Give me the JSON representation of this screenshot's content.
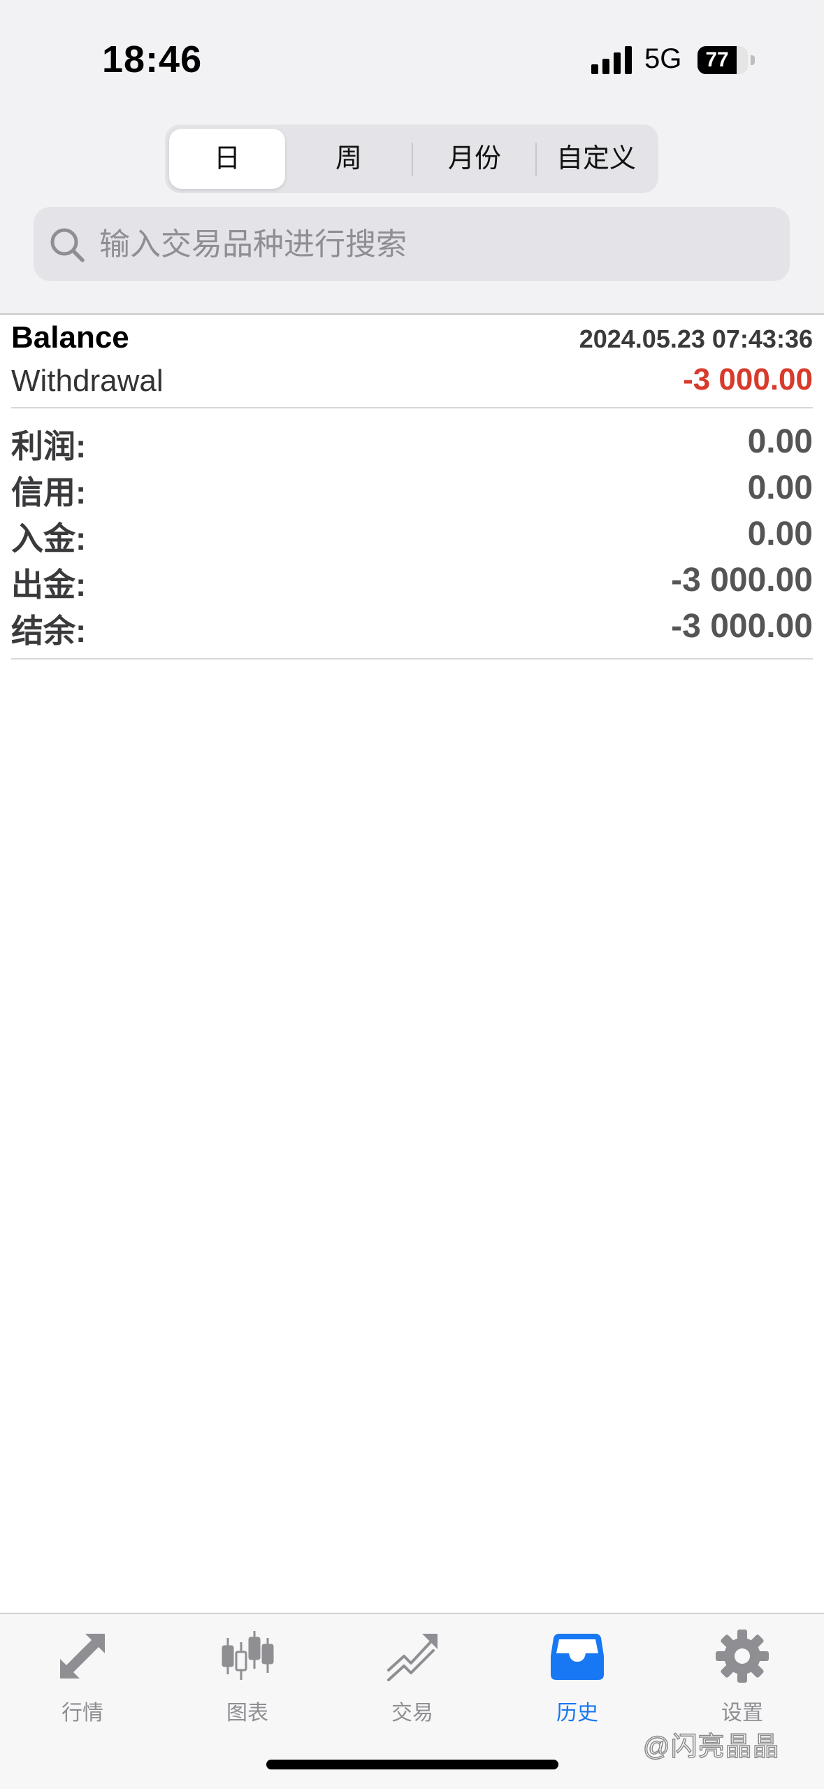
{
  "status_bar": {
    "time": "18:46",
    "network": "5G",
    "battery_level": "77"
  },
  "period_tabs": [
    {
      "label": "日",
      "active": true
    },
    {
      "label": "周",
      "active": false
    },
    {
      "label": "月份",
      "active": false
    },
    {
      "label": "自定义",
      "active": false
    }
  ],
  "search": {
    "placeholder": "输入交易品种进行搜索",
    "value": ""
  },
  "deal": {
    "title": "Balance",
    "timestamp": "2024.05.23 07:43:36",
    "type": "Withdrawal",
    "amount": "-3 000.00",
    "amount_color": "#d83a2b"
  },
  "summary": [
    {
      "label": "利润:",
      "value": "0.00"
    },
    {
      "label": "信用:",
      "value": "0.00"
    },
    {
      "label": "入金:",
      "value": "0.00"
    },
    {
      "label": "出金:",
      "value": "-3 000.00"
    },
    {
      "label": "结余:",
      "value": "-3 000.00"
    }
  ],
  "tab_bar": {
    "accent_color": "#1877f2",
    "items": [
      {
        "label": "行情",
        "icon": "quotes-arrows-icon",
        "active": false
      },
      {
        "label": "图表",
        "icon": "candlestick-chart-icon",
        "active": false
      },
      {
        "label": "交易",
        "icon": "trade-trend-icon",
        "active": false
      },
      {
        "label": "历史",
        "icon": "history-inbox-icon",
        "active": true
      },
      {
        "label": "设置",
        "icon": "gear-icon",
        "active": false
      }
    ]
  },
  "watermark": "@闪亮晶晶"
}
